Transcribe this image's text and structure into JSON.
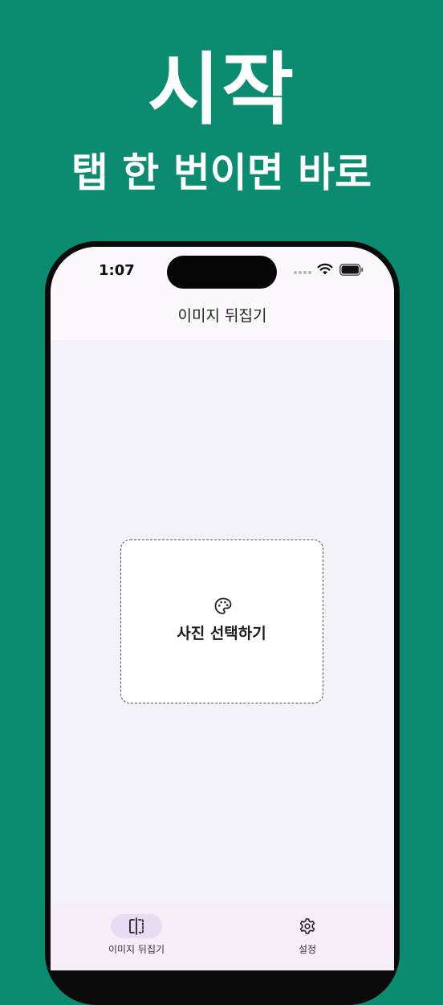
{
  "promo": {
    "headline": "시작",
    "subline": "탭 한 번이면 바로"
  },
  "status_bar": {
    "time": "1:07",
    "icons": [
      "signal-dots-icon",
      "wifi-icon",
      "battery-icon"
    ]
  },
  "nav": {
    "title": "이미지 뒤집기"
  },
  "main": {
    "pick_photo_icon": "palette-icon",
    "pick_photo_label": "사진 선택하기"
  },
  "tabbar": {
    "tabs": [
      {
        "label": "이미지 뒤집기",
        "icon": "flip-icon",
        "selected": true
      },
      {
        "label": "설정",
        "icon": "gear-icon",
        "selected": false
      }
    ]
  },
  "colors": {
    "promo_background": "#0b8c70",
    "screen_background": "#f3f2f8",
    "header_background": "#fbf7fc",
    "tab_selected_pill": "#e6dcf3"
  }
}
